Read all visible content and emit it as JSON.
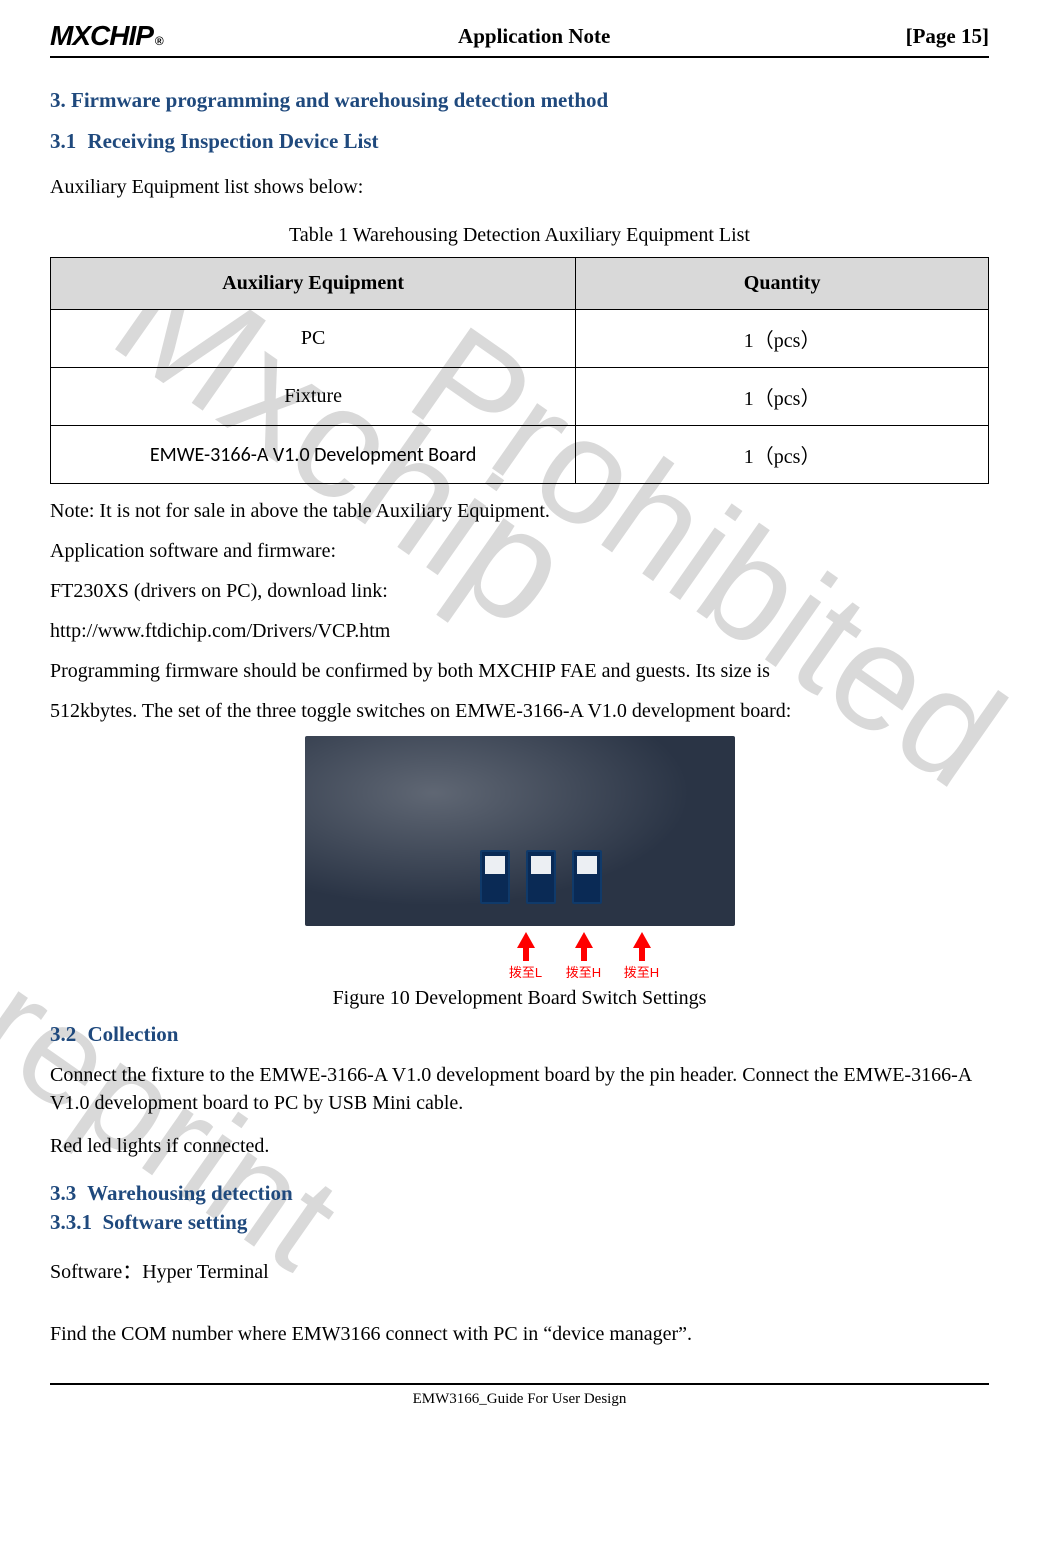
{
  "header": {
    "logo_text": "MXCHIP",
    "logo_reg": "®",
    "center": "Application  Note",
    "right": "[Page  15]"
  },
  "watermarks": {
    "wm1": "Mxchip",
    "wm2": "Prohibited",
    "wm3": "reprint"
  },
  "section3": {
    "title": "3.   Firmware programming and warehousing detection method"
  },
  "s31": {
    "heading": "Receiving Inspection Device List",
    "num": "3.1",
    "intro": "Auxiliary Equipment list shows below:",
    "table_caption": "Table 1 Warehousing Detection Auxiliary Equipment List",
    "table": {
      "head_left": "Auxiliary Equipment",
      "head_right": "Quantity",
      "rows": [
        {
          "name": "PC",
          "qty": "1（pcs）"
        },
        {
          "name": "Fixture",
          "qty": "1（pcs）"
        },
        {
          "name": "EMWE-3166-A V1.0 Development Board",
          "qty": "1（pcs）"
        }
      ]
    },
    "note": "Note: It is not for sale in above the table Auxiliary Equipment.",
    "app_sw": "Application software and firmware:",
    "drv": "FT230XS (drivers on PC), download link:",
    "drv_link": "http://www.ftdichip.com/Drivers/VCP.htm",
    "prog1": "Programming firmware should be confirmed by both MXCHIP FAE and guests. Its size is",
    "prog2": "512kbytes. The set of the three toggle switches on EMWE-3166-A V1.0 development board:",
    "figure_caption": "Figure 10 Development Board Switch Settings",
    "arrow_labels": [
      "拨至L",
      "拨至H",
      "拨至H"
    ]
  },
  "s32": {
    "num": "3.2",
    "heading": "Collection",
    "p1": "Connect the fixture to the EMWE-3166-A V1.0 development board by the pin header. Connect the EMWE-3166-A V1.0 development board to PC by USB Mini cable.",
    "p2": "Red led lights if connected."
  },
  "s33": {
    "num": "3.3",
    "heading": "Warehousing detection",
    "sub_num": "3.3.1",
    "sub_heading": "Software setting",
    "sw": "Software：Hyper Terminal",
    "find": "Find the COM number where EMW3166 connect with PC in “device manager”."
  },
  "footer": "EMW3166_Guide For User Design"
}
